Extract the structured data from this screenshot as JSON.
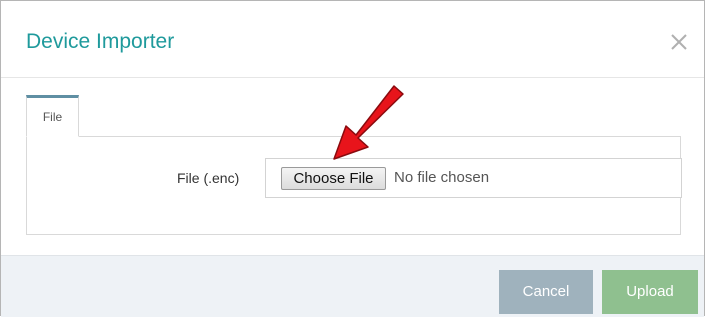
{
  "dialog": {
    "title": "Device Importer",
    "close_icon": "close-icon"
  },
  "tabs": [
    {
      "label": "File",
      "active": true
    }
  ],
  "form": {
    "file_label": "File (.enc)",
    "choose_button": "Choose File",
    "file_status": "No file chosen"
  },
  "footer": {
    "cancel_label": "Cancel",
    "upload_label": "Upload"
  },
  "colors": {
    "title": "#1f9a9c",
    "cancel": "#9fb2bd",
    "upload": "#8fc08f",
    "annotation_arrow": "#e8141b"
  }
}
